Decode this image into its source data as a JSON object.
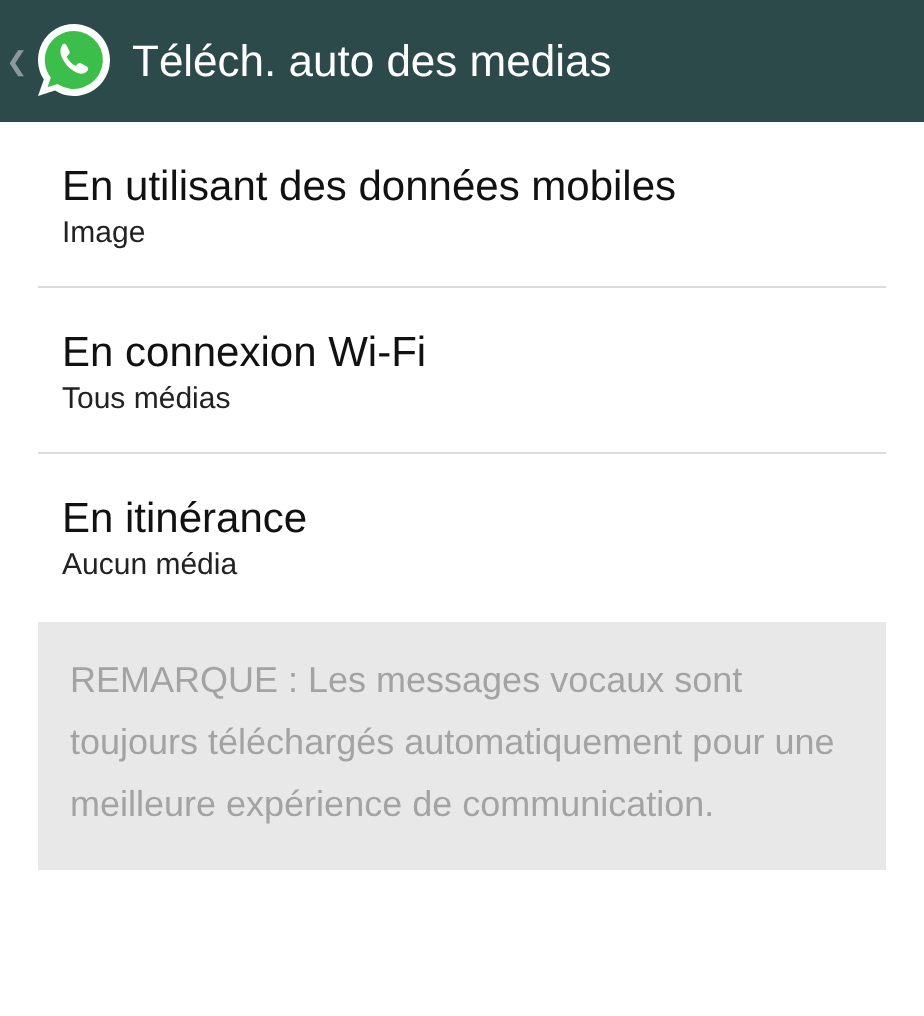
{
  "action_bar": {
    "back": "❮",
    "title": "Téléch. auto des medias"
  },
  "settings": [
    {
      "title": "En utilisant des données mobiles",
      "summary": "Image"
    },
    {
      "title": "En connexion Wi-Fi",
      "summary": "Tous médias"
    },
    {
      "title": "En itinérance",
      "summary": "Aucun média"
    }
  ],
  "note": "REMARQUE : Les messages vocaux sont toujours téléchargés automatiquement pour une meilleure expérience de communication."
}
